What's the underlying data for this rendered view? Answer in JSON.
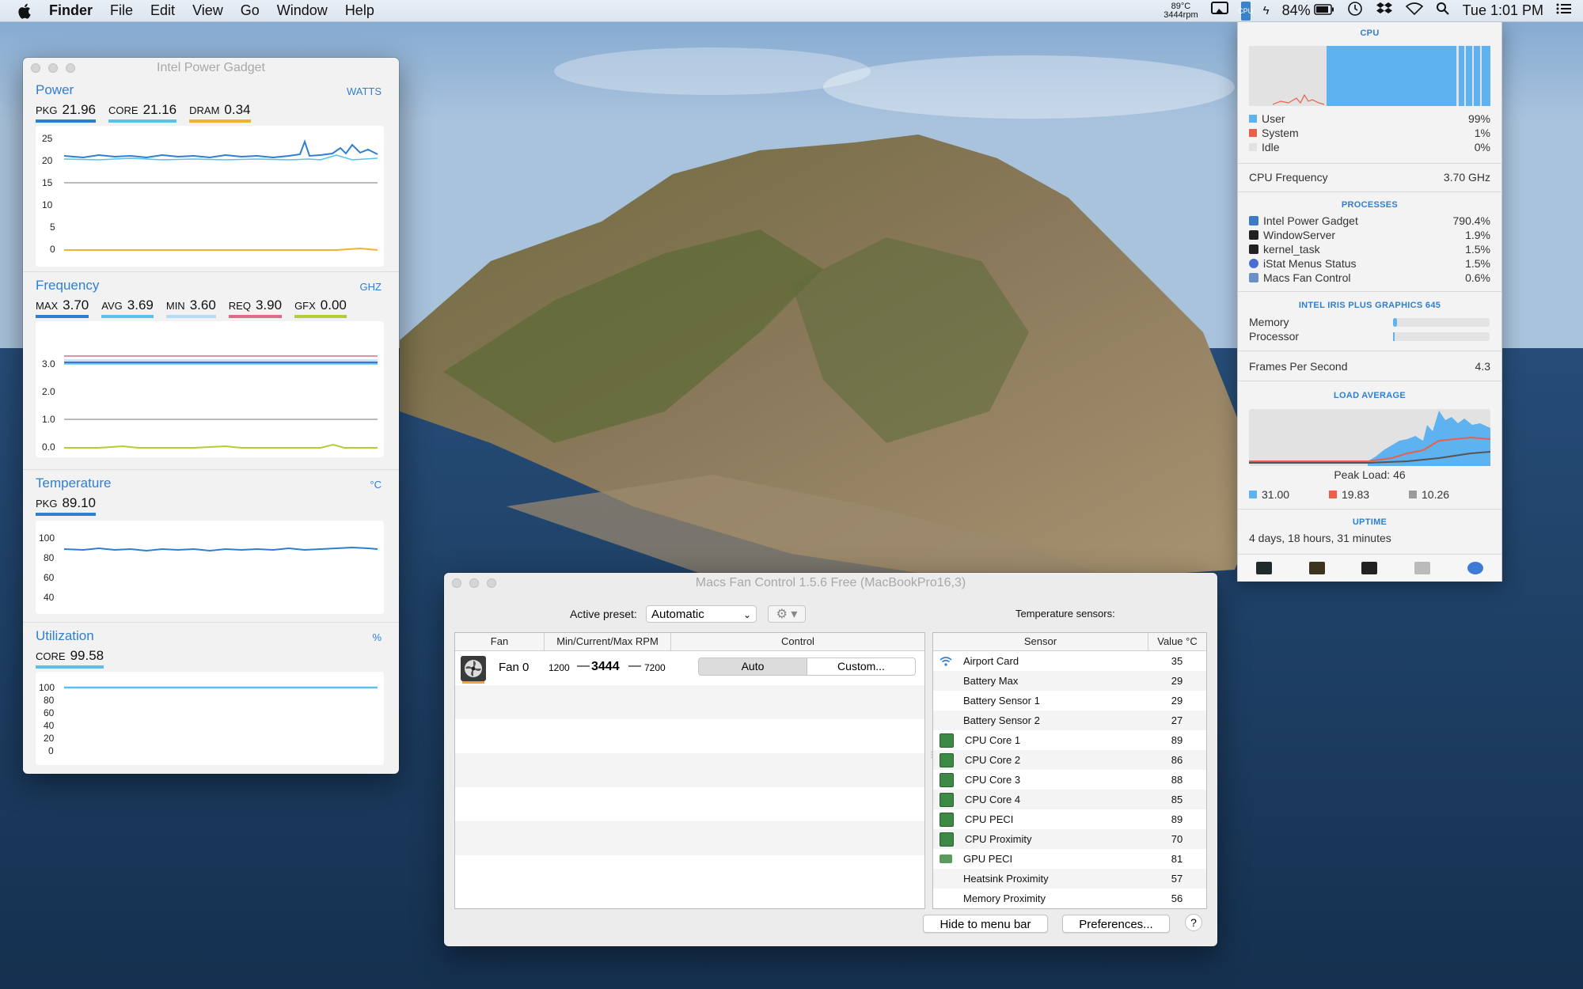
{
  "menubar": {
    "app": "Finder",
    "menus": [
      "File",
      "Edit",
      "View",
      "Go",
      "Window",
      "Help"
    ],
    "temp": "89°C",
    "fan_rpm": "3444rpm",
    "cpu_badge": "CPU",
    "battery_pct": "84%",
    "clock": "Tue 1:01 PM"
  },
  "ipg": {
    "title": "Intel Power Gadget",
    "power": {
      "title": "Power",
      "unit": "WATTS",
      "metrics": [
        {
          "label": "PKG",
          "value": "21.96",
          "color": "#2f7fd0"
        },
        {
          "label": "CORE",
          "value": "21.16",
          "color": "#5bc0eb"
        },
        {
          "label": "DRAM",
          "value": "0.34",
          "color": "#f2b134"
        }
      ],
      "ticks": [
        "25",
        "20",
        "15",
        "10",
        "5",
        "0"
      ]
    },
    "frequency": {
      "title": "Frequency",
      "unit": "GHZ",
      "metrics": [
        {
          "label": "MAX",
          "value": "3.70",
          "color": "#2f7fd0"
        },
        {
          "label": "AVG",
          "value": "3.69",
          "color": "#5bc0eb"
        },
        {
          "label": "MIN",
          "value": "3.60",
          "color": "#b6dcf7"
        },
        {
          "label": "REQ",
          "value": "3.90",
          "color": "#e06a8a"
        },
        {
          "label": "GFX",
          "value": "0.00",
          "color": "#b5cc3a"
        }
      ],
      "ticks": [
        "3.0",
        "2.0",
        "1.0",
        "0.0"
      ]
    },
    "temperature": {
      "title": "Temperature",
      "unit": "°C",
      "metrics": [
        {
          "label": "PKG",
          "value": "89.10",
          "color": "#2f7fd0"
        }
      ],
      "ticks": [
        "100",
        "80",
        "60",
        "40"
      ]
    },
    "utilization": {
      "title": "Utilization",
      "unit": "%",
      "metrics": [
        {
          "label": "CORE",
          "value": "99.58",
          "color": "#5bc0eb"
        }
      ],
      "ticks": [
        "100",
        "80",
        "60",
        "40",
        "20",
        "0"
      ]
    }
  },
  "istat": {
    "cpu": {
      "header": "CPU",
      "legend": [
        {
          "label": "User",
          "value": "99%",
          "color": "#5fb2f0"
        },
        {
          "label": "System",
          "value": "1%",
          "color": "#e8604c"
        },
        {
          "label": "Idle",
          "value": "0%",
          "color": "#e2e2e2"
        }
      ],
      "freq_label": "CPU Frequency",
      "freq_value": "3.70 GHz"
    },
    "processes": {
      "header": "PROCESSES",
      "items": [
        {
          "name": "Intel Power Gadget",
          "value": "790.4%",
          "icon_color": "#3c7ac4"
        },
        {
          "name": "WindowServer",
          "value": "1.9%",
          "icon_color": "#222222"
        },
        {
          "name": "kernel_task",
          "value": "1.5%",
          "icon_color": "#222222"
        },
        {
          "name": "iStat Menus Status",
          "value": "1.5%",
          "icon_color": "#4a6fd1"
        },
        {
          "name": "Macs Fan Control",
          "value": "0.6%",
          "icon_color": "#6c8fc7"
        }
      ]
    },
    "gpu": {
      "header": "INTEL IRIS PLUS GRAPHICS 645",
      "memory_label": "Memory",
      "memory_level": 0.04,
      "processor_label": "Processor",
      "processor_level": 0.01,
      "fps_label": "Frames Per Second",
      "fps_value": "4.3"
    },
    "load": {
      "header": "LOAD AVERAGE",
      "peak": "Peak Load: 46",
      "values": [
        {
          "value": "31.00",
          "color": "#5fb2f0"
        },
        {
          "value": "19.83",
          "color": "#e8604c"
        },
        {
          "value": "10.26",
          "color": "#9a9a9a"
        }
      ]
    },
    "uptime": {
      "header": "UPTIME",
      "value": "4 days, 18 hours, 31 minutes"
    }
  },
  "mfc": {
    "title": "Macs Fan Control 1.5.6 Free (MacBookPro16,3)",
    "active_preset_label": "Active preset:",
    "preset_value": "Automatic",
    "temp_sensors_label": "Temperature sensors:",
    "fan_columns": [
      "Fan",
      "Min/Current/Max RPM",
      "Control"
    ],
    "fan": {
      "name": "Fan 0",
      "min": "1200",
      "current": "3444",
      "max": "7200",
      "auto": "Auto",
      "custom": "Custom..."
    },
    "sensor_columns": [
      "Sensor",
      "Value °C"
    ],
    "sensors": [
      {
        "name": "Airport Card",
        "value": "35",
        "icon": "wifi-icon"
      },
      {
        "name": "Battery Max",
        "value": "29",
        "icon": ""
      },
      {
        "name": "Battery Sensor 1",
        "value": "29",
        "icon": ""
      },
      {
        "name": "Battery Sensor 2",
        "value": "27",
        "icon": ""
      },
      {
        "name": "CPU Core 1",
        "value": "89",
        "icon": "chip-icon"
      },
      {
        "name": "CPU Core 2",
        "value": "86",
        "icon": "chip-icon"
      },
      {
        "name": "CPU Core 3",
        "value": "88",
        "icon": "chip-icon"
      },
      {
        "name": "CPU Core 4",
        "value": "85",
        "icon": "chip-icon"
      },
      {
        "name": "CPU PECI",
        "value": "89",
        "icon": "chip-icon"
      },
      {
        "name": "CPU Proximity",
        "value": "70",
        "icon": "chip-icon"
      },
      {
        "name": "GPU PECI",
        "value": "81",
        "icon": "gpu-icon"
      },
      {
        "name": "Heatsink Proximity",
        "value": "57",
        "icon": ""
      },
      {
        "name": "Memory Proximity",
        "value": "56",
        "icon": ""
      }
    ],
    "hide_button": "Hide to menu bar",
    "prefs_button": "Preferences...",
    "help": "?"
  }
}
